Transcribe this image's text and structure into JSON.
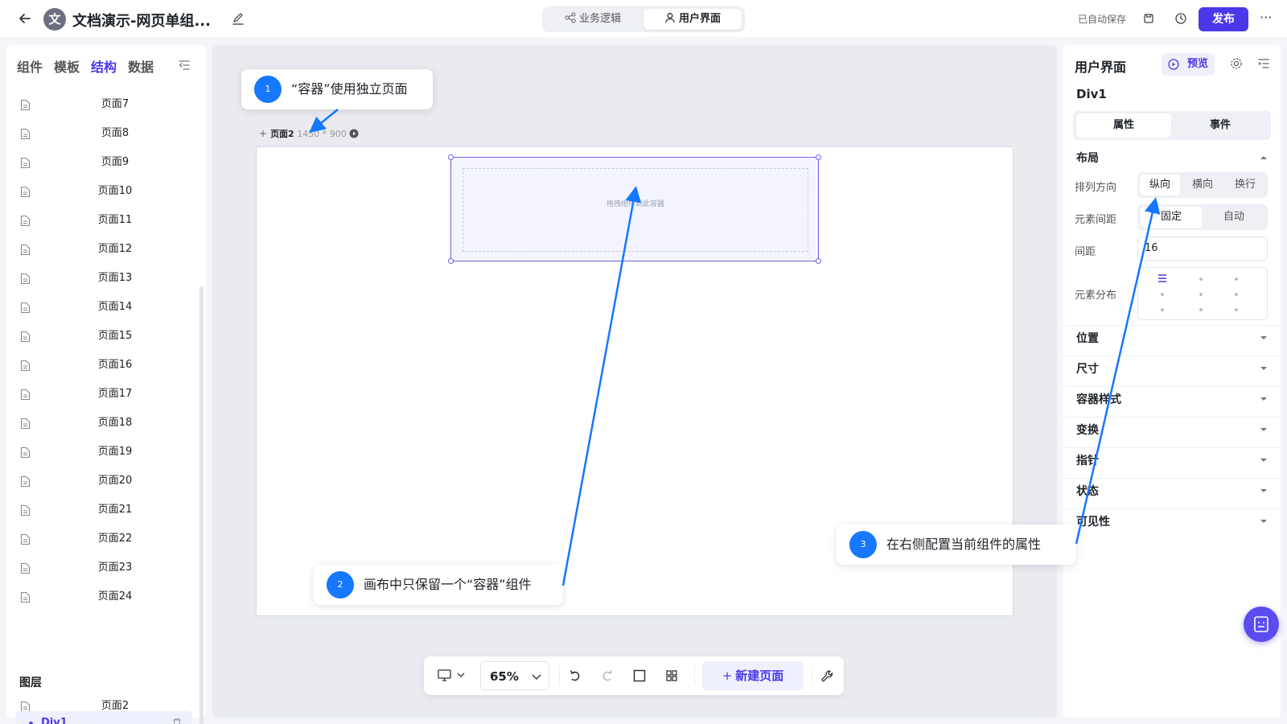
{
  "topbar": {
    "title": "文档演示-网页单组...",
    "logo_char": "文",
    "tabs": [
      {
        "label": "业务逻辑"
      },
      {
        "label": "用户界面"
      }
    ],
    "autosave": "已自动保存",
    "publish_label": "发布",
    "more": "···"
  },
  "left_panel": {
    "tabs": [
      {
        "label": "组件"
      },
      {
        "label": "模板"
      },
      {
        "label": "结构"
      },
      {
        "label": "数据"
      }
    ],
    "active_tab": "结构",
    "pages": [
      {
        "label": "页面7"
      },
      {
        "label": "页面8"
      },
      {
        "label": "页面9"
      },
      {
        "label": "页面10"
      },
      {
        "label": "页面11"
      },
      {
        "label": "页面12"
      },
      {
        "label": "页面13"
      },
      {
        "label": "页面14"
      },
      {
        "label": "页面15"
      },
      {
        "label": "页面16"
      },
      {
        "label": "页面17"
      },
      {
        "label": "页面18"
      },
      {
        "label": "页面19"
      },
      {
        "label": "页面20"
      },
      {
        "label": "页面21"
      },
      {
        "label": "页面22"
      },
      {
        "label": "页面23"
      },
      {
        "label": "页面24"
      }
    ],
    "layers_title": "图层",
    "layer_page": "页面2",
    "layer_selected": "Div1"
  },
  "canvas": {
    "page_name": "页面2",
    "page_size": "1450 * 900",
    "drop_hint": "拖拽组件到此容器",
    "zoom": "65%",
    "new_page_label": "新建页面"
  },
  "right_panel": {
    "title": "用户界面",
    "preview_label": "预览",
    "component_name": "Div1",
    "seg_tabs": [
      {
        "label": "属性"
      },
      {
        "label": "事件"
      }
    ],
    "layout_title": "布局",
    "direction_label": "排列方向",
    "direction_options": [
      {
        "label": "纵向"
      },
      {
        "label": "横向"
      },
      {
        "label": "换行"
      }
    ],
    "gap_mode_label": "元素间距",
    "gap_mode_options": [
      {
        "label": "固定"
      },
      {
        "label": "自动"
      }
    ],
    "gap_label": "间距",
    "gap_value": "16",
    "distribution_label": "元素分布",
    "sections": [
      {
        "label": "位置"
      },
      {
        "label": "尺寸"
      },
      {
        "label": "容器样式"
      },
      {
        "label": "变换"
      },
      {
        "label": "指针"
      },
      {
        "label": "状态"
      },
      {
        "label": "可见性"
      }
    ]
  },
  "annotations": [
    {
      "num": "1",
      "text": "“容器”使用独立页面"
    },
    {
      "num": "2",
      "text": "画布中只保留一个“容器”组件"
    },
    {
      "num": "3",
      "text": "在右侧配置当前组件的属性"
    }
  ],
  "colors": {
    "accent": "#4a38e8",
    "annotation": "#1677ff"
  }
}
